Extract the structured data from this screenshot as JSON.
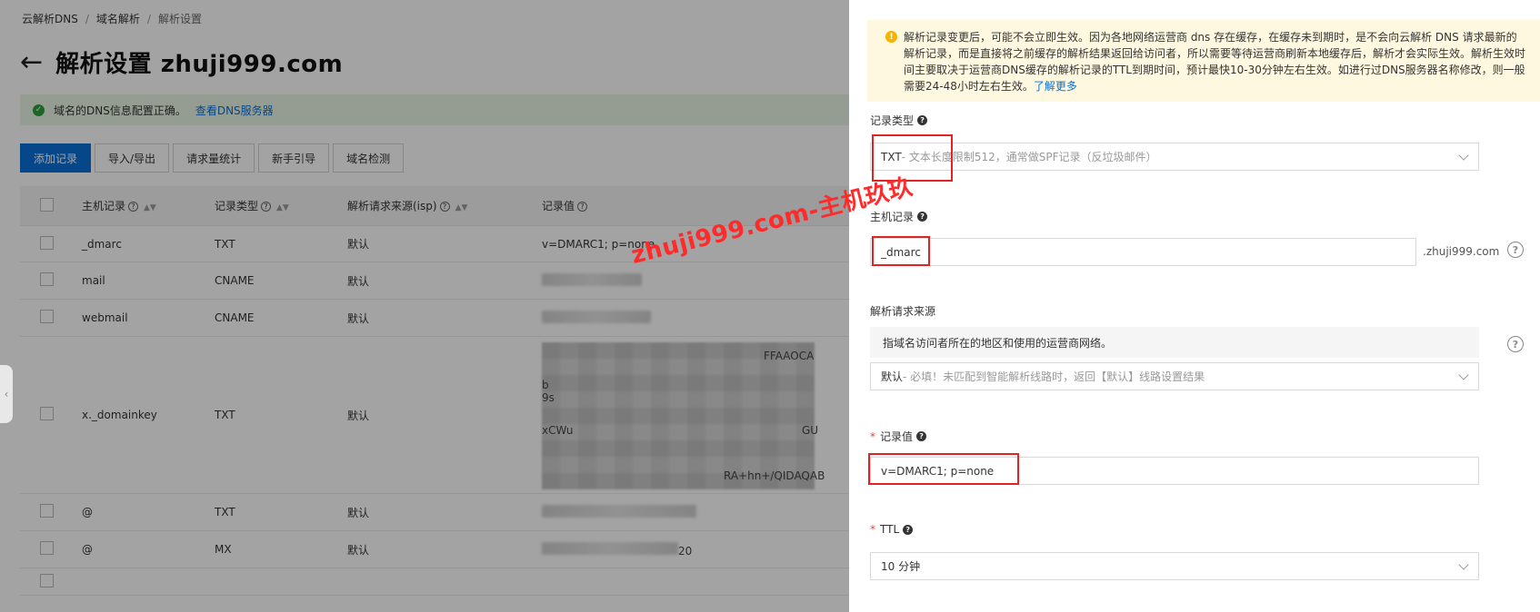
{
  "breadcrumb": [
    "云解析DNS",
    "域名解析",
    "解析设置"
  ],
  "page_title": "解析设置 zhuji999.com",
  "notice": {
    "text": "域名的DNS信息配置正确。",
    "link": "查看DNS服务器"
  },
  "toolbar": [
    "添加记录",
    "导入/导出",
    "请求量统计",
    "新手引导",
    "域名检测"
  ],
  "table": {
    "headers": {
      "host": "主机记录",
      "type": "记录类型",
      "isp": "解析请求来源(isp)",
      "value": "记录值"
    },
    "rows": [
      {
        "host": "_dmarc",
        "type": "TXT",
        "isp": "默认",
        "value": "v=DMARC1; p=none"
      },
      {
        "host": "mail",
        "type": "CNAME",
        "isp": "默认",
        "value": ""
      },
      {
        "host": "webmail",
        "type": "CNAME",
        "isp": "默认",
        "value": ""
      },
      {
        "host": "x._domainkey",
        "type": "TXT",
        "isp": "默认",
        "value_fragments": [
          "FFAAOCA",
          "b",
          "9s",
          "xCWu",
          "GU",
          "RA+hn+/QIDAQAB"
        ]
      },
      {
        "host": "@",
        "type": "TXT",
        "isp": "默认",
        "value": ""
      },
      {
        "host": "@",
        "type": "MX",
        "isp": "默认",
        "value": "20"
      }
    ]
  },
  "drawer": {
    "tip": "解析记录变更后，可能不会立即生效。因为各地网络运营商 dns 存在缓存，在缓存未到期时，是不会向云解析 DNS 请求最新的解析记录，而是直接将之前缓存的解析结果返回给访问者，所以需要等待运营商刷新本地缓存后，解析才会实际生效。解析生效时间主要取决于运营商DNS缓存的解析记录的TTL到期时间，预计最快10-30分钟左右生效。如进行过DNS服务器名称修改，则一般需要24-48小时左右生效。",
    "tip_link": "了解更多",
    "record_type": {
      "label": "记录类型",
      "value": "TXT",
      "hint": "- 文本长度限制512，通常做SPF记录（反垃圾邮件）"
    },
    "host": {
      "label": "主机记录",
      "value": "_dmarc",
      "suffix": ".zhuji999.com"
    },
    "isp": {
      "label": "解析请求来源",
      "desc": "指域名访问者所在的地区和使用的运营商网络。",
      "value": "默认",
      "hint": " - 必填！未匹配到智能解析线路时，返回【默认】线路设置结果"
    },
    "record_value": {
      "label": "记录值",
      "value": "v=DMARC1; p=none"
    },
    "ttl": {
      "label": "TTL",
      "value": "10 分钟"
    }
  },
  "watermark": "zhuji999.com-主机玖玖",
  "colors": {
    "primary": "#0a6fd6",
    "highlight": "#e02424",
    "watermark": "#ff2a2a",
    "tip_bg": "#fff8e0"
  }
}
